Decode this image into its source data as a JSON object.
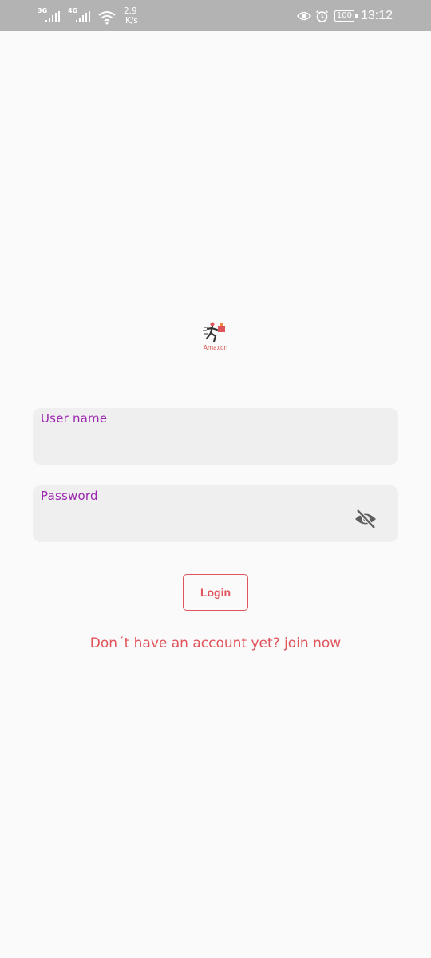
{
  "status_bar": {
    "sim1_network": "3G",
    "sim2_network": "4G",
    "speed_value": "2.9",
    "speed_unit": "K/s",
    "battery": "100",
    "time": "13:12",
    "icons": [
      "signal-icon",
      "wifi-icon",
      "eye-icon",
      "alarm-icon",
      "battery-icon"
    ]
  },
  "logo": {
    "name": "Amaxon"
  },
  "form": {
    "username_label": "User name",
    "username_value": "",
    "password_label": "Password",
    "password_value": "",
    "password_toggle_icon": "visibility-off-icon"
  },
  "login_button": "Login",
  "signup_link": "Don´t have an account yet? join now",
  "colors": {
    "accent": "#e0535a",
    "label": "#9c27b0",
    "field_bg": "#efefef",
    "status_bar_bg": "#b3b3b3"
  }
}
